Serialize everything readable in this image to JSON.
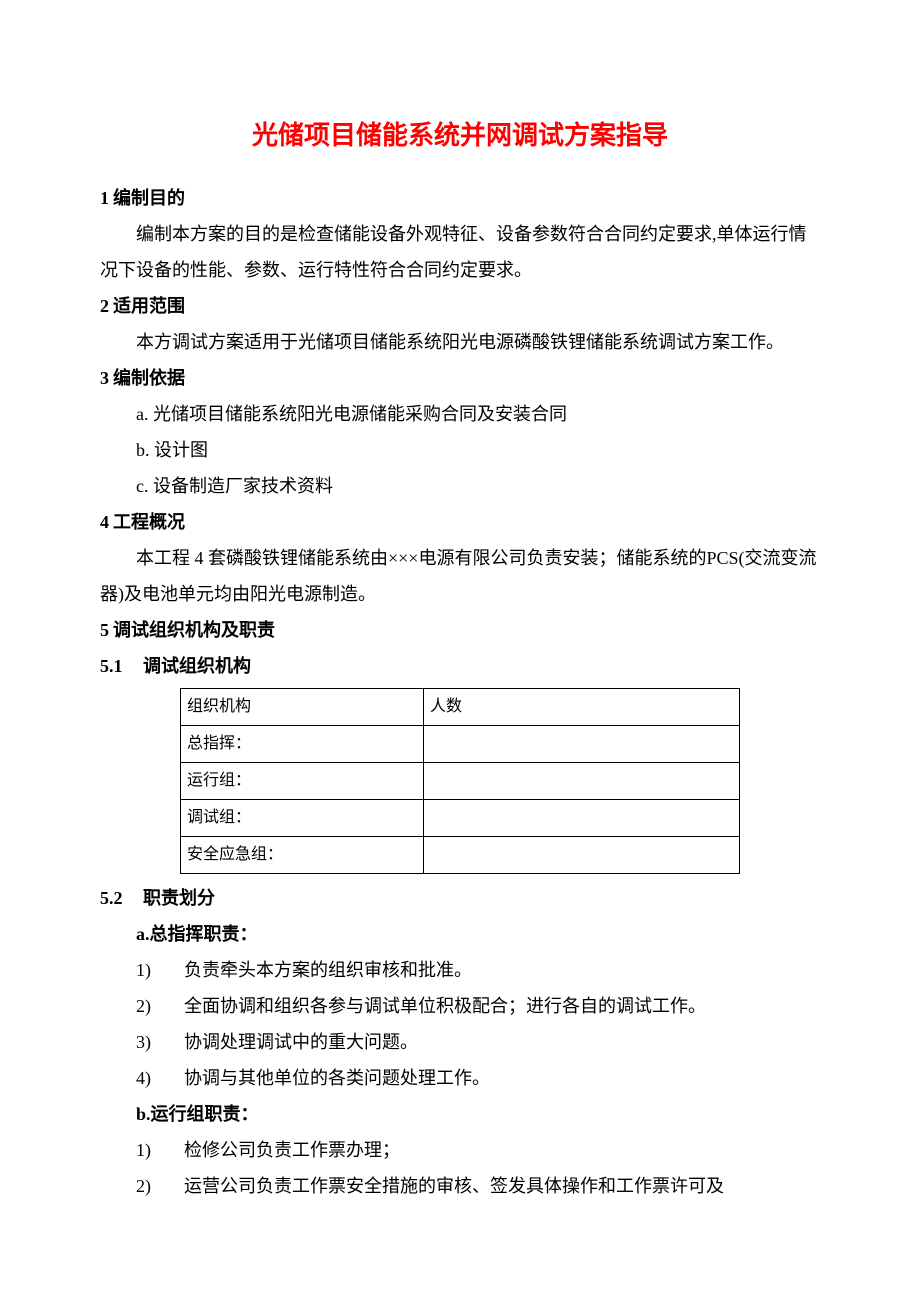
{
  "title": "光储项目储能系统并网调试方案指导",
  "s1": {
    "num": "1",
    "label": "编制目的",
    "body": "编制本方案的目的是检查储能设备外观特征、设备参数符合合同约定要求,单体运行情况下设备的性能、参数、运行特性符合合同约定要求。"
  },
  "s2": {
    "num": "2",
    "label": "适用范围",
    "body": "本方调试方案适用于光储项目储能系统阳光电源磷酸铁锂储能系统调试方案工作。"
  },
  "s3": {
    "num": "3",
    "label": "编制依据",
    "items": [
      "a. 光储项目储能系统阳光电源储能采购合同及安装合同",
      "b. 设计图",
      "c. 设备制造厂家技术资料"
    ]
  },
  "s4": {
    "num": "4",
    "label": "工程概况",
    "body": "本工程 4 套磷酸铁锂储能系统由×××电源有限公司负责安装；储能系统的PCS(交流变流器)及电池单元均由阳光电源制造。"
  },
  "s5": {
    "num": "5",
    "label": "调试组织机构及职责",
    "s51": {
      "num": "5.1",
      "label": "调试组织机构"
    },
    "table": {
      "header": [
        "组织机构",
        "人数"
      ],
      "rows": [
        [
          "总指挥：",
          ""
        ],
        [
          "运行组：",
          ""
        ],
        [
          "调试组：",
          ""
        ],
        [
          "安全应急组：",
          ""
        ]
      ]
    },
    "s52": {
      "num": "5.2",
      "label": "职责划分"
    },
    "a": {
      "head": "a.总指挥职责：",
      "items": [
        {
          "n": "1)",
          "t": "负责牵头本方案的组织审核和批准。"
        },
        {
          "n": "2)",
          "t": "全面协调和组织各参与调试单位积极配合；进行各自的调试工作。"
        },
        {
          "n": "3)",
          "t": "协调处理调试中的重大问题。"
        },
        {
          "n": "4)",
          "t": "协调与其他单位的各类问题处理工作。"
        }
      ]
    },
    "b": {
      "head": "b.运行组职责：",
      "items": [
        {
          "n": "1)",
          "t": "检修公司负责工作票办理；"
        },
        {
          "n": "2)",
          "t": "运营公司负责工作票安全措施的审核、签发具体操作和工作票许可及"
        }
      ]
    }
  }
}
